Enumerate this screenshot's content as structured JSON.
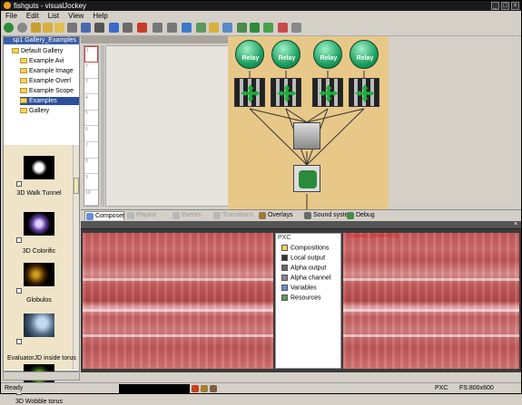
{
  "window": {
    "title": "fishguts - visualJockey",
    "controls": [
      "_",
      "□",
      "×"
    ]
  },
  "menu": [
    "File",
    "Edit",
    "List",
    "View",
    "Help"
  ],
  "toolbar": {
    "icons": [
      "back-icon",
      "forward-icon",
      "save-icon",
      "open-icon",
      "folder-icon",
      "save2-icon",
      "undo-icon",
      "cut-icon",
      "copy-icon",
      "paste-icon",
      "delete-icon",
      "up-icon",
      "down-icon",
      "gallery-icon",
      "refresh-icon",
      "light-icon",
      "link-icon",
      "node-icon",
      "add-node-icon",
      "record-icon",
      "output-icon",
      "zoom-icon"
    ]
  },
  "tree": {
    "header": "sp1 Gallery_Examples",
    "items": [
      {
        "label": "Default Gallery",
        "indent": 1,
        "selected": false
      },
      {
        "label": "Example Avi",
        "indent": 2,
        "selected": false
      },
      {
        "label": "Example Image",
        "indent": 2,
        "selected": false
      },
      {
        "label": "Example Overl",
        "indent": 2,
        "selected": false
      },
      {
        "label": "Example Scope",
        "indent": 2,
        "selected": false
      },
      {
        "label": "Examples",
        "indent": 2,
        "selected": true
      },
      {
        "label": "Gallery",
        "indent": 2,
        "selected": false
      }
    ]
  },
  "gallery": {
    "items": [
      {
        "label": "3D Walk Tunnel"
      },
      {
        "label": "3D Colorific"
      },
      {
        "label": "Globulos"
      },
      {
        "label": "EvaluatorJD inside torus"
      },
      {
        "label": "3D Wobble torus"
      }
    ]
  },
  "timeline": {
    "rows": [
      "1",
      "2",
      "3",
      "4",
      "5",
      "6",
      "7",
      "8",
      "9",
      "10"
    ]
  },
  "composer": {
    "relays": [
      "Relay",
      "Relay",
      "Relay",
      "Relay"
    ]
  },
  "tabs": [
    {
      "label": "Composer",
      "active": true,
      "dim": false,
      "color": "#6a8fd0"
    },
    {
      "label": "Playlist",
      "active": false,
      "dim": true,
      "color": "#b8b8b8"
    },
    {
      "label": "Events",
      "active": false,
      "dim": true,
      "color": "#b8b8b8"
    },
    {
      "label": "Transitions",
      "active": false,
      "dim": true,
      "color": "#b8b8b8"
    },
    {
      "label": "Overlays",
      "active": false,
      "dim": false,
      "color": "#9a7a40"
    },
    {
      "label": "Sound system",
      "active": false,
      "dim": false,
      "color": "#6a6a6a"
    },
    {
      "label": "Debug",
      "active": false,
      "dim": false,
      "color": "#4a8a4a"
    }
  ],
  "output": {
    "left_label": "",
    "right_label": "Camera: (fs900×600)",
    "pxc": {
      "title": "PXC",
      "items": [
        {
          "label": "Compositions",
          "icon_color": "#f5d35a"
        },
        {
          "label": "Local output",
          "icon_color": "#333333"
        },
        {
          "label": "Alpha output",
          "icon_color": "#666666"
        },
        {
          "label": "Alpha channel",
          "icon_color": "#888888"
        },
        {
          "label": "Variables",
          "icon_color": "#6a8fd0"
        },
        {
          "label": "Resources",
          "icon_color": "#5a9a5a"
        }
      ]
    }
  },
  "status": {
    "left": "Ready",
    "pxc": "PXC",
    "fs": "FS:800x600"
  },
  "colors": {
    "canvas_bg": "#e8c888",
    "relay": "#1da060",
    "title_bg": "#1a1a1a"
  }
}
